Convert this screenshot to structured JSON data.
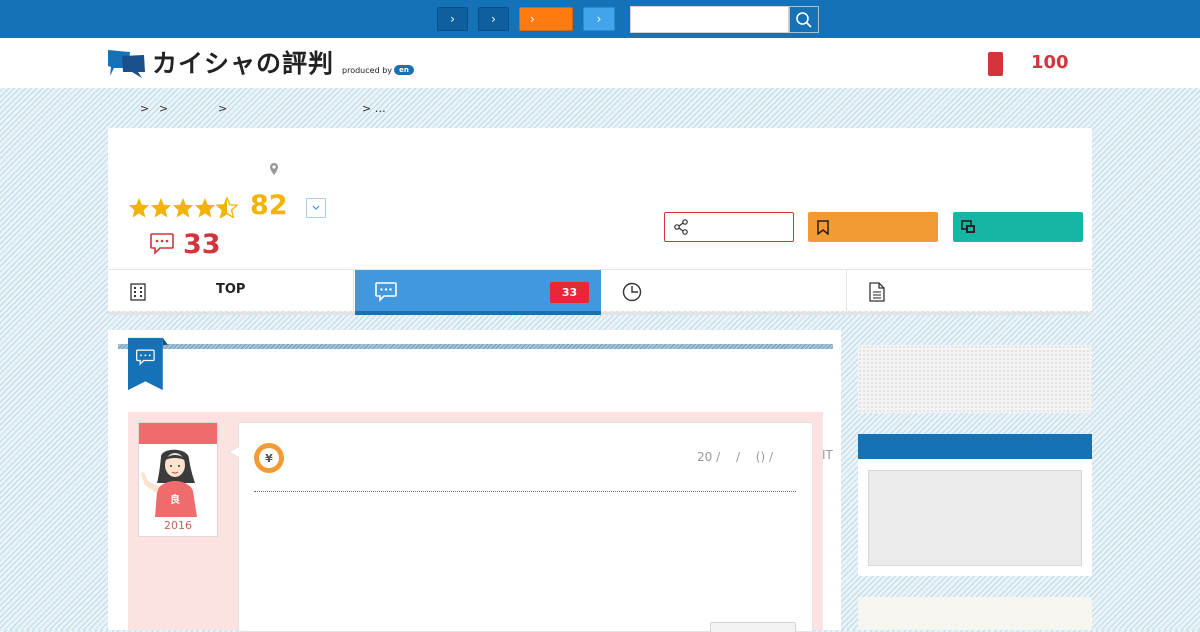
{
  "topbar": {
    "nav_buttons": [
      {
        "label": "›",
        "color": "#0d5fa0"
      },
      {
        "label": "›",
        "color": "#0d5fa0"
      },
      {
        "label": "›",
        "color": "#ff7b10"
      },
      {
        "label": "›",
        "color": "#42a4ea"
      }
    ],
    "search": {
      "value": "",
      "placeholder": "",
      "icon": "search-icon"
    }
  },
  "header": {
    "logo_text": "カイシャの評判",
    "produced_by": "produced by",
    "en_badge": "en",
    "favorites_count": "100"
  },
  "breadcrumb": {
    "separators": [
      ">",
      ">",
      ">",
      "> …"
    ]
  },
  "company": {
    "rating": "82",
    "stars_full": 4,
    "stars_half": 1,
    "review_count": "33",
    "rating_toggle_icon": "chevron-down-icon"
  },
  "actions": {
    "share_icon": "share-icon",
    "bookmark_icon": "bookmark-icon",
    "compare_icon": "compare-icon"
  },
  "tabs": [
    {
      "label": "TOP",
      "icon": "building-icon"
    },
    {
      "label": "",
      "icon": "chat-icon",
      "badge": "33",
      "active": true
    },
    {
      "label": "",
      "icon": "clock-icon"
    },
    {
      "label": "",
      "icon": "document-icon"
    }
  ],
  "review": {
    "avatar_year": "2016",
    "avatar_shirt_char": "良",
    "category_icon": "yen-icon",
    "category_char": "¥",
    "meta": "20 /　 /　 () /",
    "meta_suffix": "IT"
  },
  "colors": {
    "primary": "#1572b6",
    "accent_red": "#d4343c",
    "star": "#f2b400",
    "bookmark": "#f29a33",
    "compare": "#17b5a3"
  }
}
